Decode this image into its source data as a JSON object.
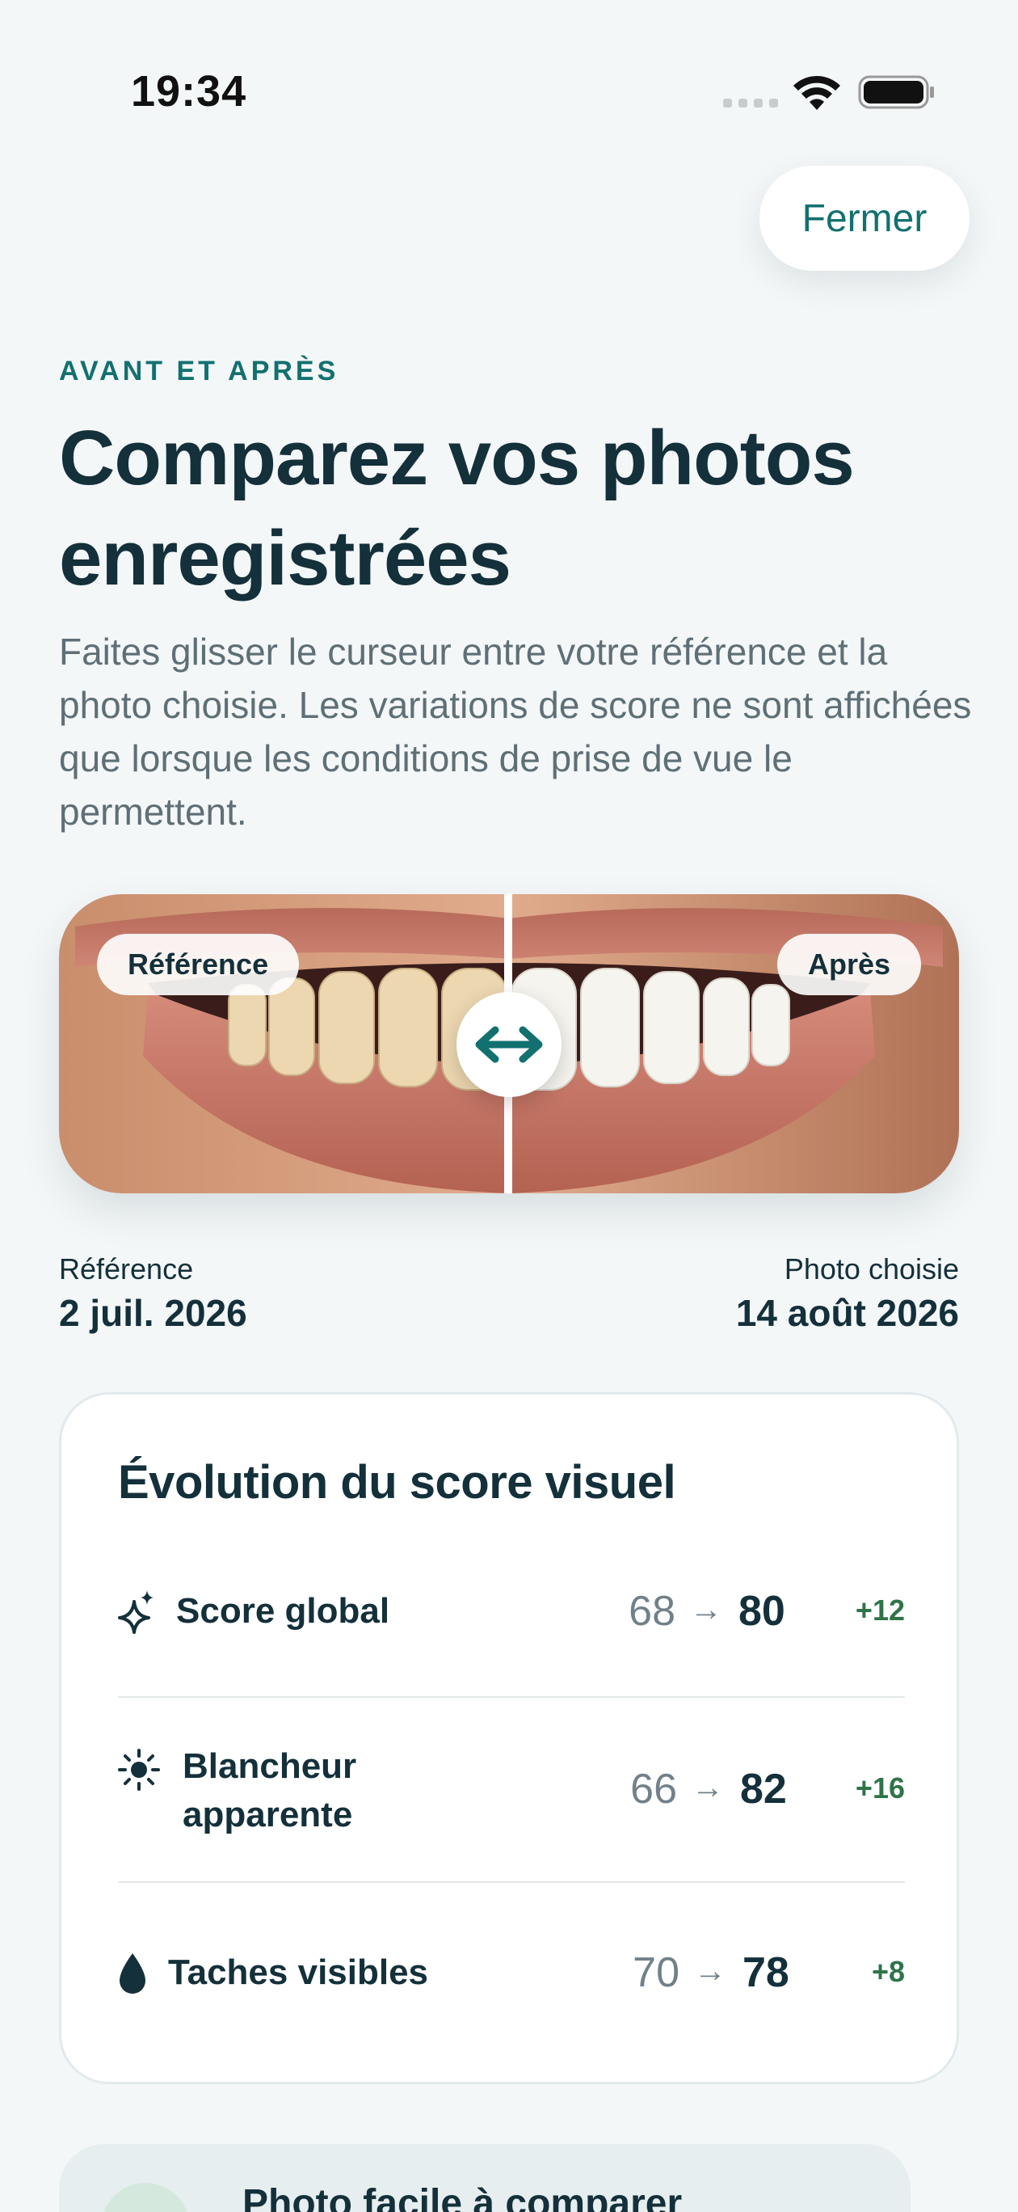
{
  "status": {
    "time": "19:34"
  },
  "header": {
    "close_label": "Fermer"
  },
  "intro": {
    "eyebrow": "AVANT ET APRÈS",
    "title": "Comparez vos photos enregistrées",
    "subtitle": "Faites glisser le curseur entre votre référence et la photo choisie. Les variations de score ne sont affichées que lorsque les conditions de prise de vue le permettent."
  },
  "comparison": {
    "left_tag": "Référence",
    "right_tag": "Après",
    "handle_icon": "left-right-arrow-icon"
  },
  "dates": {
    "reference_label": "Référence",
    "reference_value": "2 juil. 2026",
    "chosen_label": "Photo choisie",
    "chosen_value": "14 août 2026"
  },
  "score_card": {
    "title": "Évolution du score visuel",
    "rows": [
      {
        "icon": "sparkle-icon",
        "name": "Score global",
        "before": "68",
        "after": "80",
        "delta": "+12"
      },
      {
        "icon": "sun-icon",
        "name": "Blancheur apparente",
        "before": "66",
        "after": "82",
        "delta": "+16"
      },
      {
        "icon": "drop-icon",
        "name": "Taches visibles",
        "before": "70",
        "after": "78",
        "delta": "+8"
      }
    ]
  },
  "tip_card": {
    "title": "Photo facile à comparer"
  },
  "colors": {
    "accent": "#12716f",
    "positive": "#2f7449",
    "text": "#14303a",
    "muted": "#5f6f76"
  }
}
